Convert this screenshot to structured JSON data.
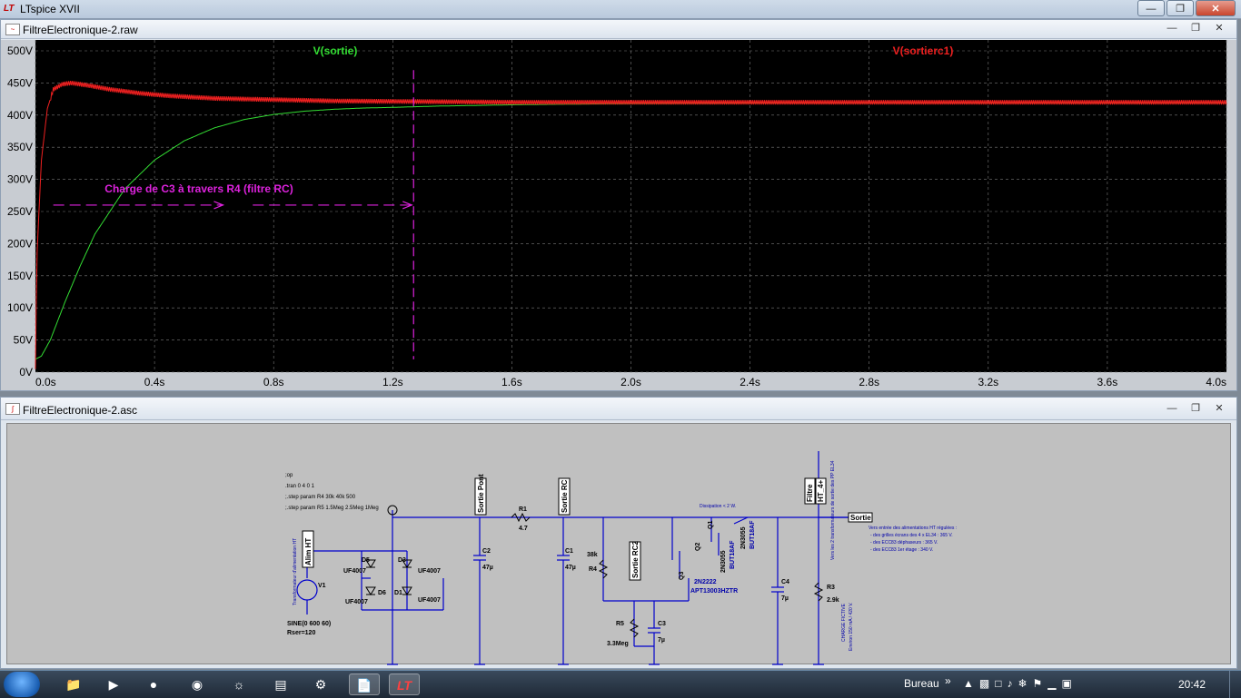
{
  "app": {
    "title": "LTspice XVII",
    "logo": "LT"
  },
  "plot_window": {
    "title": "FiltreElectronique-2.raw",
    "traces": [
      {
        "name": "V(sortie)",
        "color": "#33dd33"
      },
      {
        "name": "V(sortierc1)",
        "color": "#ee2020"
      }
    ],
    "annotation": "Charge de C3 à travers R4 (filtre RC)",
    "annotation_color": "#dd22dd"
  },
  "chart_data": {
    "type": "line",
    "xlim": [
      0,
      4.0
    ],
    "ylim": [
      0,
      500
    ],
    "x_ticks": [
      "0.0s",
      "0.4s",
      "0.8s",
      "1.2s",
      "1.6s",
      "2.0s",
      "2.4s",
      "2.8s",
      "3.2s",
      "3.6s",
      "4.0s"
    ],
    "y_ticks": [
      "0V",
      "50V",
      "100V",
      "150V",
      "200V",
      "250V",
      "300V",
      "350V",
      "400V",
      "450V",
      "500V"
    ],
    "grid": true,
    "series": [
      {
        "name": "V(sortie)",
        "x": [
          0,
          0.02,
          0.05,
          0.1,
          0.15,
          0.2,
          0.3,
          0.4,
          0.5,
          0.6,
          0.7,
          0.8,
          0.9,
          1.0,
          1.1,
          1.2,
          1.35,
          1.6,
          2.0,
          2.5,
          3.0,
          3.5,
          4.0
        ],
        "y": [
          20,
          25,
          50,
          110,
          165,
          215,
          285,
          330,
          360,
          380,
          393,
          401,
          406,
          409,
          411,
          412,
          414,
          416,
          418,
          419,
          419,
          419,
          419
        ]
      },
      {
        "name": "V(sortierc1)",
        "x": [
          0,
          0.005,
          0.02,
          0.04,
          0.06,
          0.09,
          0.12,
          0.18,
          0.25,
          0.35,
          0.45,
          0.6,
          0.8,
          1.0,
          1.3,
          1.6,
          2.0,
          2.5,
          3.0,
          3.5,
          4.0
        ],
        "y": [
          5,
          180,
          330,
          410,
          440,
          448,
          450,
          446,
          440,
          434,
          430,
          426,
          424,
          422,
          421,
          420,
          420,
          420,
          420,
          420,
          420
        ]
      }
    ],
    "cursor_x": 1.27
  },
  "schematic_window": {
    "title": "FiltreElectronique-2.asc",
    "directives": [
      ";op",
      ".tran 0 4 0 1",
      ";.step param R4 30k 40k 500",
      ";.step param R5 1.5Meg 2.5Meg 1Meg"
    ],
    "labels": {
      "v1": "V1",
      "v1_value": "SINE(0 600 60)",
      "v1_rser": "Rser=120",
      "d5": "D5",
      "d3": "D3",
      "d6": "D6",
      "d1": "D1",
      "uf1": "UF4007",
      "uf2": "UF4007",
      "uf3": "UF4007",
      "uf4": "UF4007",
      "r1": "R1",
      "r1_val": "4.7",
      "c2": "C2",
      "c2_val": "47µ",
      "c1": "C1",
      "c1_val": "47µ",
      "r4": "R4",
      "r4_val": "38k",
      "r5": "R5",
      "r5_val": "3.3Meg",
      "c3": "C3",
      "c3_val": "7µ",
      "q1": "Q1",
      "q2": "Q2",
      "q3": "Q3",
      "q1_part": "2N3055",
      "q1_part2": "BUT18AF",
      "q2_part": "2N3055",
      "q2_part2": "BUT18AF",
      "q3_part": "2N2222",
      "q3_part2": "APT13003HZTR",
      "dissipation": "Dissipation < 2 W.",
      "c4": "C4",
      "c4_val": "7µ",
      "r3": "R3",
      "r3_val": "2.9k",
      "net_sortie": "Sortie",
      "net_pont": "Sortie Pont",
      "net_rc": "Sortie RC",
      "net_rc2": "Sortie RC2",
      "net_filtre": "Filtre",
      "net_ht": "HT_4+",
      "net_alim": "Alim HT",
      "note1": "Vers entrée des alimentations HT régulées :",
      "note2": "- des grilles écrans des 4 x EL34 : 365 V.",
      "note3": "- des ECC83 déphaseurs : 365 V.",
      "note4": "- des ECC83 1er étage : 340 V.",
      "vtext1": "Transformateur d'alimentation HT",
      "vtext2": "Vers les 2 transformateurs de sortie des PP EL34",
      "vtext3": "CHARGE FICTIVE",
      "vtext4": "Environ 150 mA / 420 V."
    }
  },
  "taskbar": {
    "label_bureau": "Bureau",
    "time": "20:42"
  }
}
